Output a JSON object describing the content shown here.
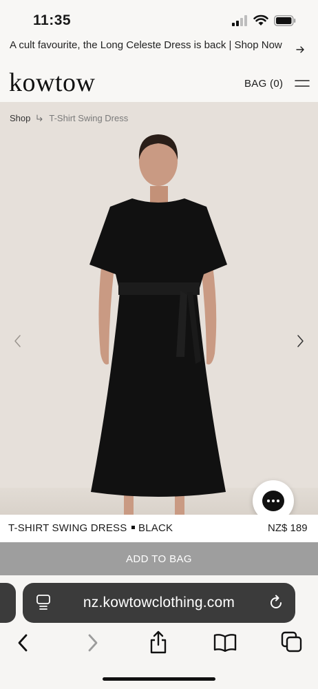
{
  "status": {
    "time": "11:35"
  },
  "announcement": {
    "text": "A cult favourite, the Long Celeste Dress is back | Shop Now"
  },
  "header": {
    "logo": "kowtow",
    "bag_label": "BAG",
    "bag_count": "(0)"
  },
  "breadcrumb": {
    "items": [
      "Shop",
      "T-Shirt Swing Dress"
    ]
  },
  "product": {
    "name": "T-SHIRT SWING DRESS",
    "color": "BLACK",
    "price": "NZ$ 189",
    "add_label": "ADD TO BAG"
  },
  "browser": {
    "url": "nz.kowtowclothing.com"
  },
  "colors": {
    "hero_bg": "#e6e0da",
    "add_button": "#9e9e9e",
    "url_bar": "#3b3b3b"
  }
}
